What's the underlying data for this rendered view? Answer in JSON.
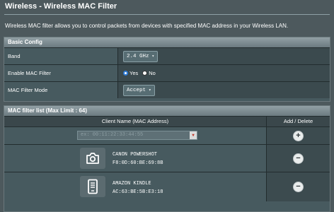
{
  "page": {
    "title": "Wireless - Wireless MAC Filter",
    "description": "Wireless MAC filter allows you to control packets from devices with specified MAC address in your Wireless LAN."
  },
  "basic_config": {
    "header": "Basic Config",
    "band": {
      "label": "Band",
      "value": "2.4 GHz"
    },
    "enable": {
      "label": "Enable MAC Filter",
      "yes_label": "Yes",
      "no_label": "No",
      "selected": "Yes"
    },
    "mode": {
      "label": "MAC Filter Mode",
      "value": "Accept"
    }
  },
  "mac_list": {
    "header": "MAC filter list (Max Limit : 64)",
    "col_client": "Client Name (MAC Address)",
    "col_action": "Add / Delete",
    "input_placeholder": "ex: 00:11:22:33:44:55",
    "devices": [
      {
        "name": "CANON POWERSHOT",
        "mac": "F8:0D:60:BE:69:8B",
        "icon": "camera-icon"
      },
      {
        "name": "AMAZON KINDLE",
        "mac": "AC:63:BE:5B:E3:18",
        "icon": "tablet-icon"
      }
    ]
  },
  "colors": {
    "background": "#4d595d",
    "panel_header": "#7f8d92",
    "radio_selected": "#2e7bd6",
    "dropdown_arrow": "#c0392b"
  }
}
